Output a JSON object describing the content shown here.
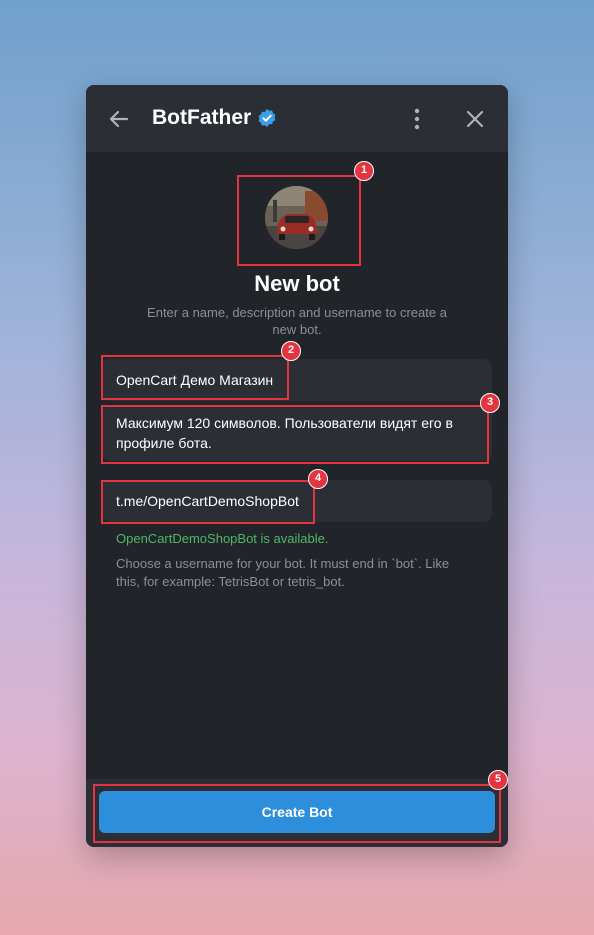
{
  "header": {
    "title": "BotFather",
    "back_icon": "arrow-left-icon",
    "verified_icon": "verified-badge-icon",
    "menu_icon": "more-vertical-icon",
    "close_icon": "close-icon"
  },
  "main": {
    "avatar_icon": "bot-avatar-image",
    "heading": "New bot",
    "subtitle": "Enter a name, description and username to create a new bot.",
    "name_value": "OpenCart Демо Магазин",
    "description_placeholder": "Максимум 120 символов. Пользователи видят его в профиле бота.",
    "username_value": "t.me/OpenCartDemoShopBot",
    "available_text": "OpenCartDemoShopBot is available.",
    "hint_text": "Choose a username for your bot. It must end in `bot`. Like this, for example: TetrisBot or tetris_bot."
  },
  "footer": {
    "create_label": "Create Bot"
  },
  "annotations": [
    "1",
    "2",
    "3",
    "4",
    "5"
  ],
  "colors": {
    "accent": "#2d8edb",
    "available": "#4fb767",
    "highlight": "#e3343f",
    "panel": "#212429"
  }
}
